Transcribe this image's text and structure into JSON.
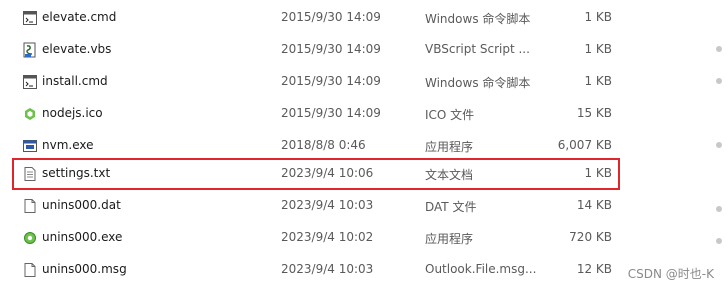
{
  "files": [
    {
      "name": "elevate.cmd",
      "date": "2015/9/30 14:09",
      "type": "Windows 命令脚本",
      "size": "1 KB",
      "icon": "cmd-icon"
    },
    {
      "name": "elevate.vbs",
      "date": "2015/9/30 14:09",
      "type": "VBScript Script ...",
      "size": "1 KB",
      "icon": "vbs-icon"
    },
    {
      "name": "install.cmd",
      "date": "2015/9/30 14:09",
      "type": "Windows 命令脚本",
      "size": "1 KB",
      "icon": "cmd-icon"
    },
    {
      "name": "nodejs.ico",
      "date": "2015/9/30 14:09",
      "type": "ICO 文件",
      "size": "15 KB",
      "icon": "nodejs-icon"
    },
    {
      "name": "nvm.exe",
      "date": "2018/8/8 0:46",
      "type": "应用程序",
      "size": "6,007 KB",
      "icon": "exe-icon"
    },
    {
      "name": "settings.txt",
      "date": "2023/9/4 10:06",
      "type": "文本文档",
      "size": "1 KB",
      "icon": "txt-icon",
      "highlighted": true
    },
    {
      "name": "unins000.dat",
      "date": "2023/9/4 10:03",
      "type": "DAT 文件",
      "size": "14 KB",
      "icon": "file-icon"
    },
    {
      "name": "unins000.exe",
      "date": "2023/9/4 10:02",
      "type": "应用程序",
      "size": "720 KB",
      "icon": "installer-icon"
    },
    {
      "name": "unins000.msg",
      "date": "2023/9/4 10:03",
      "type": "Outlook.File.msg...",
      "size": "12 KB",
      "icon": "file-icon"
    }
  ],
  "watermark": "CSDN @时也-K",
  "colors": {
    "highlight_border": "#e0262b",
    "text": "#1a1a1a",
    "muted": "#5a5a5a"
  }
}
